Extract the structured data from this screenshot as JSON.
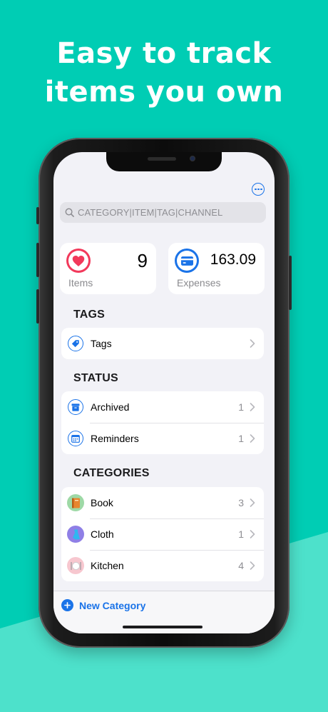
{
  "headline": {
    "line1": "Easy to track",
    "line2": "items you own"
  },
  "colors": {
    "background": "#00CDB4",
    "wedge": "#4DE1CB",
    "accent": "#1A73E8",
    "heart": "#F2395B"
  },
  "toolbar": {
    "more_icon": "ellipsis-circle-icon"
  },
  "search": {
    "placeholder": "CATEGORY|ITEM|TAG|CHANNEL",
    "icon": "search-icon"
  },
  "stats": [
    {
      "icon": "heart-icon",
      "value": "9",
      "label": "Items"
    },
    {
      "icon": "credit-card-icon",
      "value": "163.09",
      "label": "Expenses"
    }
  ],
  "tags": {
    "title": "TAGS",
    "items": [
      {
        "label": "Tags",
        "icon": "tag-icon"
      }
    ]
  },
  "status": {
    "title": "STATUS",
    "items": [
      {
        "label": "Archived",
        "count": "1",
        "icon": "archive-box-icon"
      },
      {
        "label": "Reminders",
        "count": "1",
        "icon": "calendar-icon"
      }
    ]
  },
  "categories": {
    "title": "CATEGORIES",
    "items": [
      {
        "label": "Book",
        "count": "3",
        "icon": "book-icon"
      },
      {
        "label": "Cloth",
        "count": "1",
        "icon": "cloth-icon"
      },
      {
        "label": "Kitchen",
        "count": "4",
        "icon": "kitchen-plate-icon"
      }
    ]
  },
  "bottom": {
    "new_category_label": "New Category"
  }
}
